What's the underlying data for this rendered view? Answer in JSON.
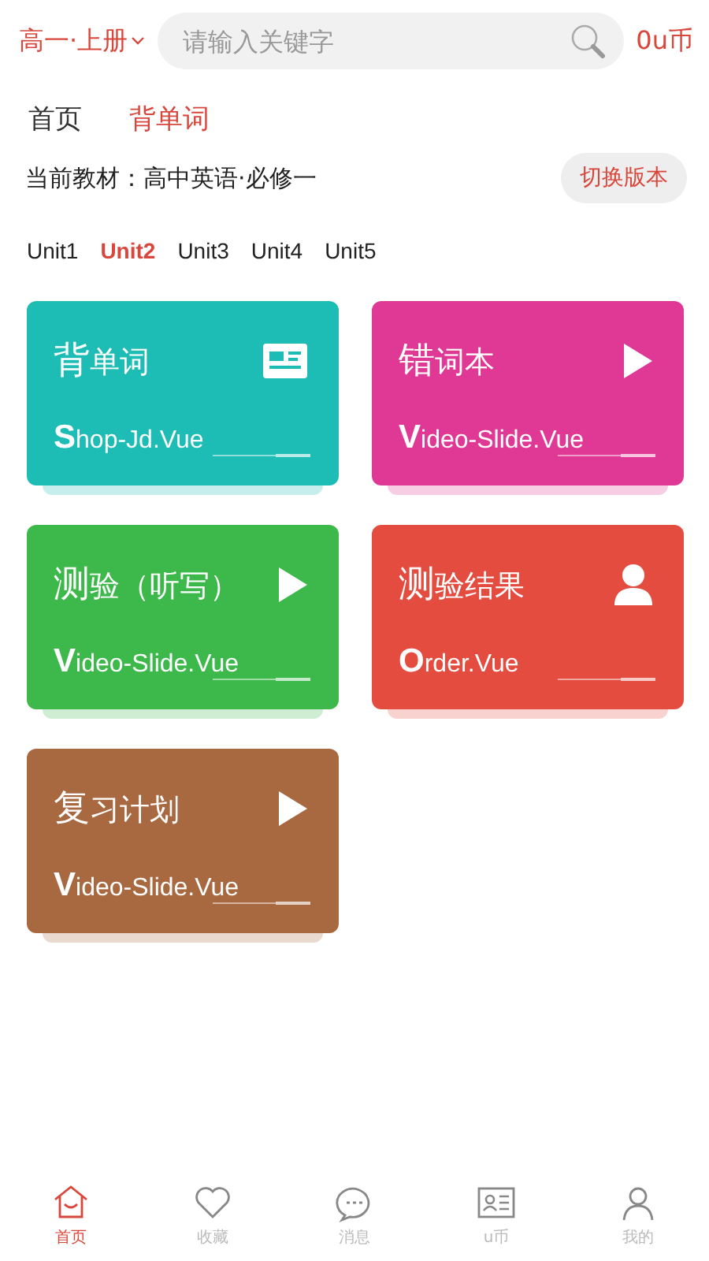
{
  "header": {
    "grade": "高一·上册",
    "search": {
      "placeholder": "请输入关键字"
    },
    "coins": "0u币"
  },
  "tabs": [
    {
      "label": "首页",
      "selected": false
    },
    {
      "label": "背单词",
      "selected": true
    }
  ],
  "textbook": {
    "label": "当前教材：高中英语·必修一",
    "button": "切换版本"
  },
  "units": [
    {
      "label": "Unit1",
      "selected": false
    },
    {
      "label": "Unit2",
      "selected": true
    },
    {
      "label": "Unit3",
      "selected": false
    },
    {
      "label": "Unit4",
      "selected": false
    },
    {
      "label": "Unit5",
      "selected": false
    }
  ],
  "cards": [
    {
      "title": "背单词",
      "subtitle": "Shop-Jd.Vue",
      "color": "#1dbdb5",
      "kind": "card"
    },
    {
      "title": "错词本",
      "subtitle": "Video-Slide.Vue",
      "color": "#e03995",
      "kind": "play"
    },
    {
      "title": "测验（听写）",
      "subtitle": "Video-Slide.Vue",
      "color": "#3cb94a",
      "kind": "play"
    },
    {
      "title": "测验结果",
      "subtitle": "Order.Vue",
      "color": "#e54c40",
      "kind": "person"
    },
    {
      "title": "复习计划",
      "subtitle": "Video-Slide.Vue",
      "color": "#a86840",
      "kind": "play"
    }
  ],
  "bottom_nav": [
    {
      "label": "首页",
      "kind": "home",
      "selected": true
    },
    {
      "label": "收藏",
      "kind": "heart",
      "selected": false
    },
    {
      "label": "消息",
      "kind": "chat",
      "selected": false
    },
    {
      "label": "u币",
      "kind": "idcard",
      "selected": false
    },
    {
      "label": "我的",
      "kind": "user",
      "selected": false
    }
  ]
}
